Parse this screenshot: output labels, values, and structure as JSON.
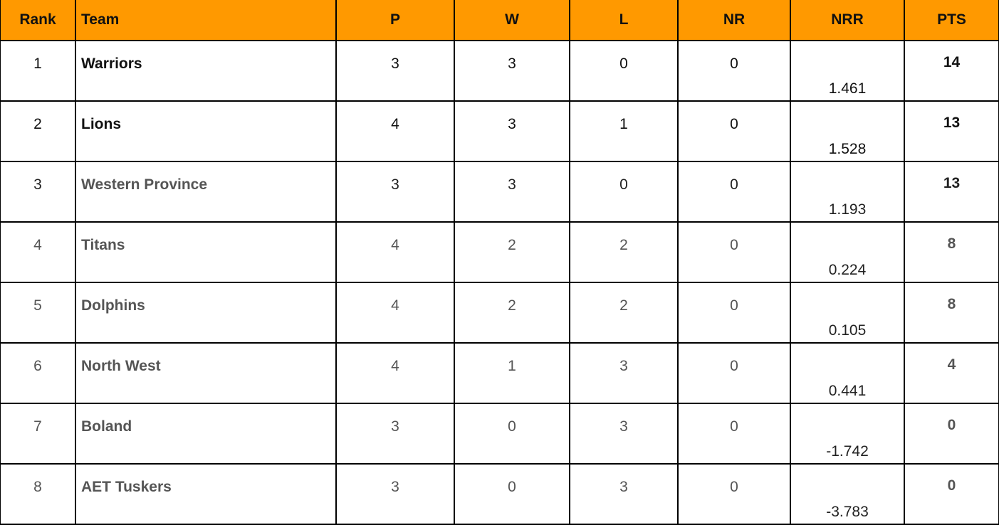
{
  "table": {
    "headers": [
      "Rank",
      "Team",
      "P",
      "W",
      "L",
      "NR",
      "NRR",
      "PTS"
    ],
    "header_color": "#ff9900",
    "rows": [
      {
        "rank": "1",
        "team": "Warriors",
        "p": "3",
        "w": "3",
        "l": "0",
        "nr": "0",
        "nrr": "1.461",
        "pts": "14"
      },
      {
        "rank": "2",
        "team": "Lions",
        "p": "4",
        "w": "3",
        "l": "1",
        "nr": "0",
        "nrr": "1.528",
        "pts": "13"
      },
      {
        "rank": "3",
        "team": "Western Province",
        "p": "3",
        "w": "3",
        "l": "0",
        "nr": "0",
        "nrr": "1.193",
        "pts": "13"
      },
      {
        "rank": "4",
        "team": "Titans",
        "p": "4",
        "w": "2",
        "l": "2",
        "nr": "0",
        "nrr": "0.224",
        "pts": "8"
      },
      {
        "rank": "5",
        "team": "Dolphins",
        "p": "4",
        "w": "2",
        "l": "2",
        "nr": "0",
        "nrr": "0.105",
        "pts": "8"
      },
      {
        "rank": "6",
        "team": "North West",
        "p": "4",
        "w": "1",
        "l": "3",
        "nr": "0",
        "nrr": "0.441",
        "pts": "4"
      },
      {
        "rank": "7",
        "team": "Boland",
        "p": "3",
        "w": "0",
        "l": "3",
        "nr": "0",
        "nrr": "-1.742",
        "pts": "0"
      },
      {
        "rank": "8",
        "team": "AET Tuskers",
        "p": "3",
        "w": "0",
        "l": "3",
        "nr": "0",
        "nrr": "-3.783",
        "pts": "0"
      }
    ]
  }
}
